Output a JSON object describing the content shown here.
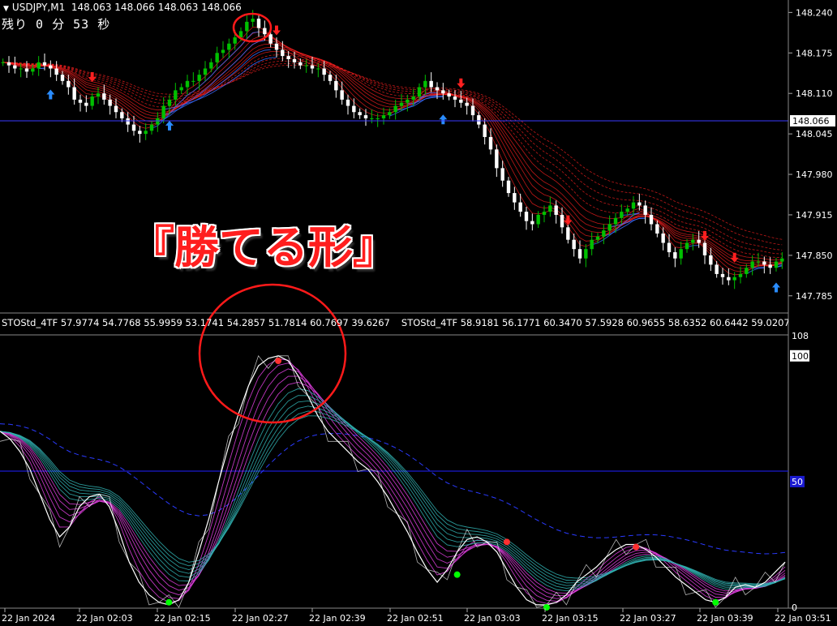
{
  "header": {
    "symbol": "USDJPY,M1",
    "ohlc": "148.063 148.066 148.063 148.066",
    "timer": "残り 0 分 53 秒"
  },
  "headline": "『勝てる形』",
  "indicator": {
    "label_1": "STOStd_4TF 57.9774 54.7768 55.9959 53.1741 54.2857 51.7814 60.7697 39.6267",
    "label_2": "STOStd_4TF 58.9181 56.1771 60.3470 57.5928 60.9655 58.6352 60.6442 59.0207",
    "label_3": "ST"
  },
  "colors": {
    "bull_candle": "#00c000",
    "bear_candle": "#ffffff",
    "ma_red": "#ff2020",
    "ma_blue": "#3a6cff",
    "osc_magenta": "#e040e0",
    "osc_teal": "#30b0b0",
    "annotation": "#ff1a1a",
    "level_line": "#1a1ad0"
  },
  "chart_data": [
    {
      "type": "candlestick",
      "symbol": "USDJPY",
      "timeframe": "M1",
      "ylim": [
        147.76,
        148.26
      ],
      "y_ticks": [
        "148.240",
        "148.175",
        "148.110",
        "148.045",
        "147.980",
        "147.915",
        "147.850",
        "147.785"
      ],
      "current_price": "148.066",
      "close_series": [
        148.16,
        148.155,
        148.15,
        148.15,
        148.145,
        148.15,
        148.16,
        148.155,
        148.15,
        148.14,
        148.13,
        148.12,
        148.1,
        148.095,
        148.09,
        148.105,
        148.11,
        148.1,
        148.09,
        148.08,
        148.07,
        148.06,
        148.05,
        148.045,
        148.05,
        148.06,
        148.07,
        148.09,
        148.1,
        148.115,
        148.12,
        148.13,
        148.13,
        148.14,
        148.15,
        148.16,
        148.175,
        148.18,
        148.19,
        148.2,
        148.21,
        148.225,
        148.23,
        148.215,
        148.205,
        148.19,
        148.18,
        148.17,
        148.165,
        148.16,
        148.155,
        148.155,
        148.15,
        148.15,
        148.14,
        148.13,
        148.115,
        148.1,
        148.09,
        148.08,
        148.075,
        148.07,
        148.07,
        148.07,
        148.075,
        148.08,
        148.09,
        148.095,
        148.1,
        148.105,
        148.12,
        148.13,
        148.12,
        148.115,
        148.11,
        148.105,
        148.1,
        148.095,
        148.09,
        148.075,
        148.06,
        148.04,
        148.02,
        147.99,
        147.97,
        147.95,
        147.935,
        147.92,
        147.905,
        147.9,
        147.915,
        147.92,
        147.93,
        147.915,
        147.895,
        147.875,
        147.86,
        147.845,
        147.86,
        147.875,
        147.88,
        147.89,
        147.9,
        147.91,
        147.92,
        147.925,
        147.935,
        147.93,
        147.915,
        147.9,
        147.885,
        147.87,
        147.855,
        147.845,
        147.86,
        147.87,
        147.875,
        147.87,
        147.85,
        147.835,
        147.82,
        147.815,
        147.81,
        147.815,
        147.82,
        147.83,
        147.84,
        147.84,
        147.835,
        147.83,
        147.84,
        147.845
      ],
      "up_arrows": [
        8,
        28,
        74,
        130,
        135,
        142,
        147
      ],
      "down_arrows": [
        15,
        46,
        77,
        95,
        118,
        123,
        140
      ]
    },
    {
      "type": "line",
      "name": "STOStd_4TF",
      "ylim": [
        0,
        108
      ],
      "y_ticks": [
        "108",
        "100",
        "50",
        "0"
      ],
      "level": 50,
      "x_ticks": [
        "22 Jan 2024",
        "22 Jan 02:03",
        "22 Jan 02:15",
        "22 Jan 02:27",
        "22 Jan 02:39",
        "22 Jan 02:51",
        "22 Jan 03:03",
        "22 Jan 03:15",
        "22 Jan 03:27",
        "22 Jan 03:39",
        "22 Jan 03:51"
      ],
      "main_series": [
        70,
        67,
        62,
        55,
        45,
        35,
        28,
        32,
        40,
        44,
        45,
        40,
        30,
        18,
        10,
        5,
        2,
        1,
        3,
        10,
        22,
        35,
        50,
        64,
        77,
        88,
        96,
        99,
        100,
        98,
        92,
        84,
        76,
        70,
        66,
        62,
        58,
        55,
        50,
        44,
        37,
        30,
        22,
        15,
        10,
        15,
        22,
        27,
        28,
        26,
        22,
        15,
        8,
        3,
        1,
        1,
        2,
        5,
        10,
        13,
        16,
        20,
        23,
        25,
        25,
        23,
        20,
        16,
        12,
        9,
        6,
        3,
        2,
        4,
        8,
        9,
        8,
        10,
        14,
        18
      ],
      "signal_dots": [
        {
          "x": 17,
          "y": 2,
          "color": "#00ff00"
        },
        {
          "x": 28,
          "y": 98,
          "color": "#ff3030"
        },
        {
          "x": 46,
          "y": 13,
          "color": "#00ff00"
        },
        {
          "x": 51,
          "y": 26,
          "color": "#ff3030"
        },
        {
          "x": 55,
          "y": 0,
          "color": "#00ff00"
        },
        {
          "x": 64,
          "y": 24,
          "color": "#ff3030"
        },
        {
          "x": 72,
          "y": 2,
          "color": "#00ff00"
        }
      ]
    }
  ]
}
